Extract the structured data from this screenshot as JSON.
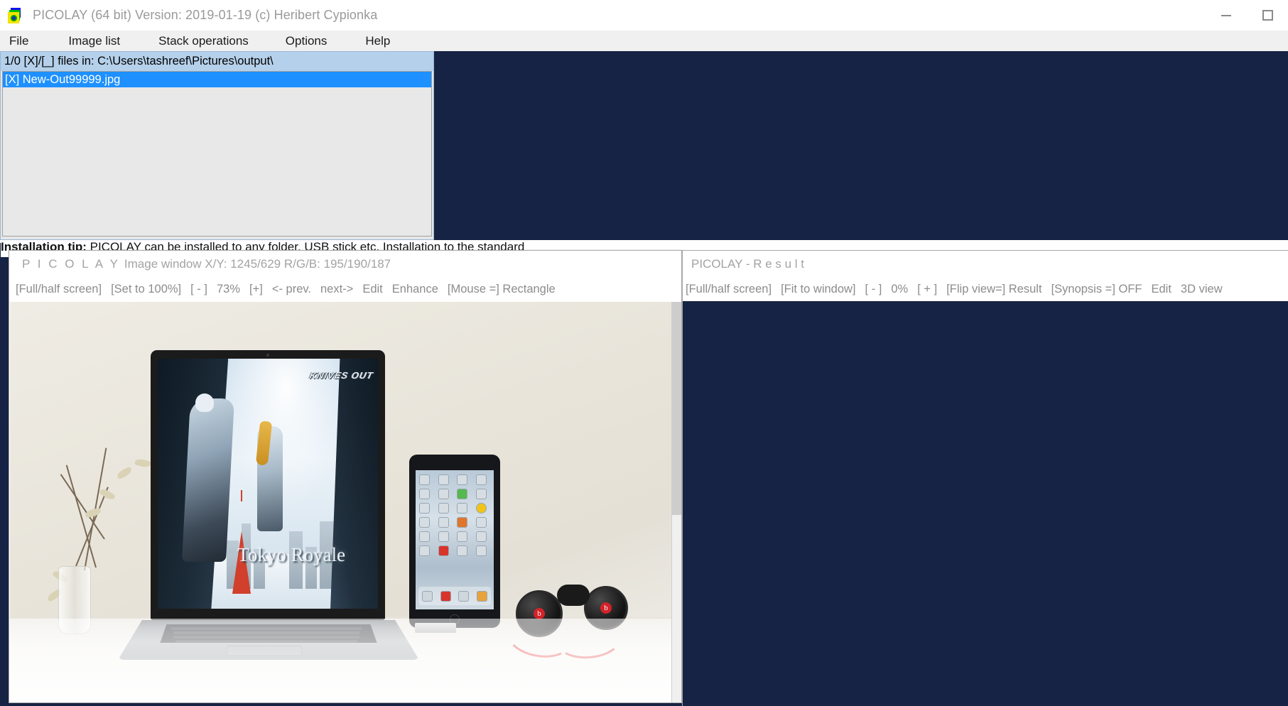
{
  "window": {
    "icon": "picolay-logo-icon",
    "title": "PICOLAY  (64 bit) Version: 2019-01-19  (c) Heribert Cypionka",
    "minimize_label": "",
    "maximize_label": ""
  },
  "menubar": {
    "items": [
      {
        "label": "File"
      },
      {
        "label": "Image list"
      },
      {
        "label": "Stack operations"
      },
      {
        "label": "Options"
      },
      {
        "label": "Help"
      }
    ]
  },
  "file_list": {
    "header": "1/0 [X]/[_] files in: C:\\Users\\tashreef\\Pictures\\output\\",
    "rows": [
      {
        "label": "[X] New-Out99999.jpg",
        "selected": true
      }
    ]
  },
  "background_text": {
    "tip_bold": "Installation tip:",
    "tip_rest": " PICOLAY can be installed to any folder, USB stick etc. Installation to the standard",
    "fragments": [
      "I",
      "c",
      "a",
      "B",
      "I",
      "'"
    ]
  },
  "image_window": {
    "title_brand": "P I C O L A Y",
    "title_info": "Image window X/Y: 1245/629 R/G/B: 195/190/187",
    "toolbar": [
      "[Full/half screen]",
      "[Set to 100%]",
      "[ - ]",
      "73%",
      "[+]",
      "<- prev.",
      "next->",
      "Edit",
      "Enhance",
      "[Mouse =] Rectangle"
    ],
    "zoom_level": "73%",
    "photo": {
      "game_logo": "KNIVES OUT",
      "game_title": "Tokyo Royale",
      "beats_logo": "b"
    }
  },
  "result_window": {
    "title": "PICOLAY  -  R e s u l t",
    "toolbar": [
      "[Full/half screen]",
      "[Fit to window]",
      "[ - ]",
      "0%",
      "[ + ]",
      "[Flip view=] Result",
      "[Synopsis =] OFF",
      "Edit",
      "3D view"
    ],
    "zoom_level": "0%",
    "synopsis_state": "OFF"
  },
  "colors": {
    "desktop_navy": "#162344",
    "chrome_gray": "#f0f0f0",
    "list_header_blue": "#b5d0ea",
    "selection_blue": "#1e90ff",
    "muted_text": "#a3a3a3"
  }
}
